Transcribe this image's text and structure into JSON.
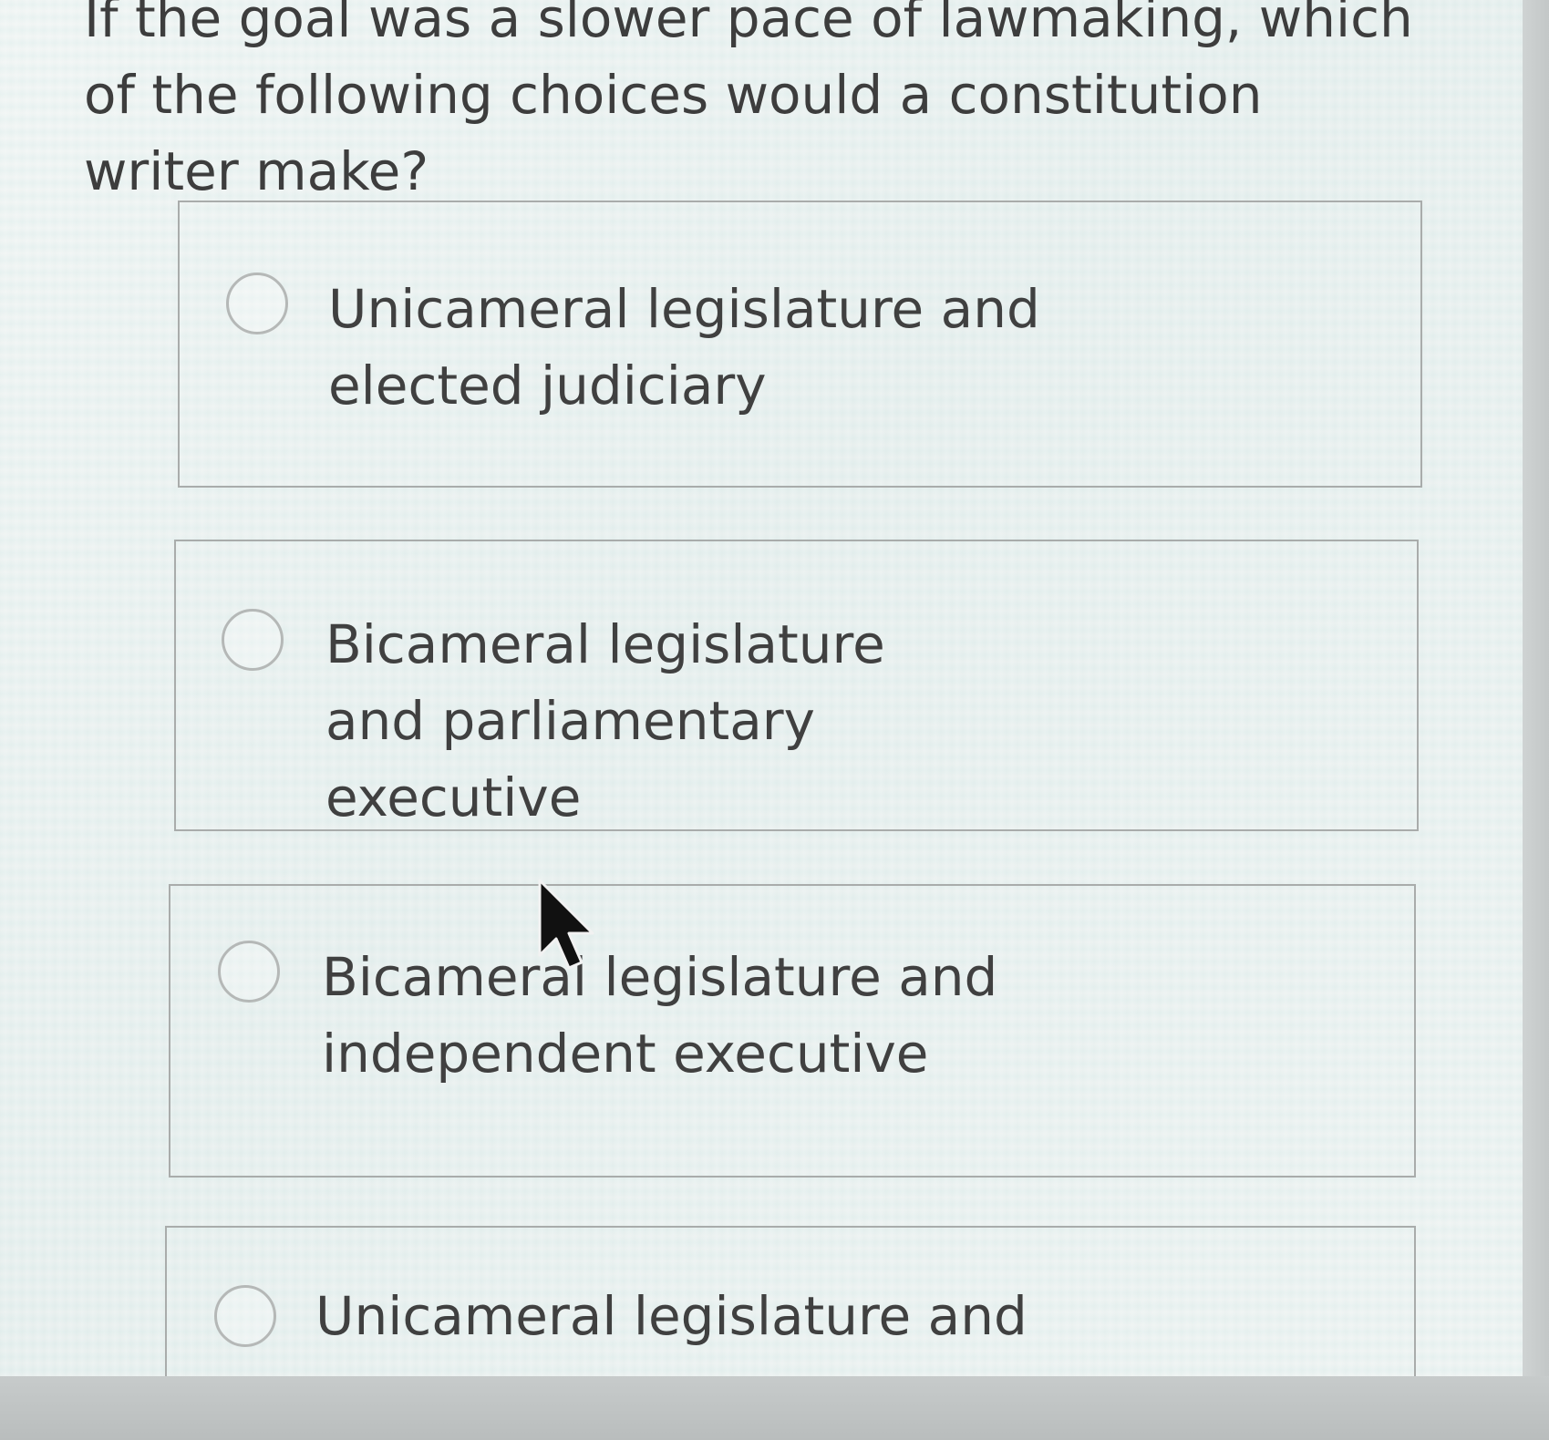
{
  "question": {
    "text": "If the goal was a slower pace of lawmaking, which of the following choices would a constitution writer make?"
  },
  "options": [
    {
      "label": "Unicameral legislature and elected judiciary",
      "selected": false
    },
    {
      "label": "Bicameral legislature and parliamentary executive",
      "selected": false
    },
    {
      "label": "Bicameral legislature and independent executive",
      "selected": false
    },
    {
      "label": "Unicameral legislature and",
      "selected": false
    }
  ],
  "icons": {
    "radio": "radio-circle-icon",
    "pointer": "mouse-pointer-icon"
  },
  "colors": {
    "text": "#3d3d3d",
    "border": "#a9acab",
    "radio_border": "#b5b8b7"
  }
}
